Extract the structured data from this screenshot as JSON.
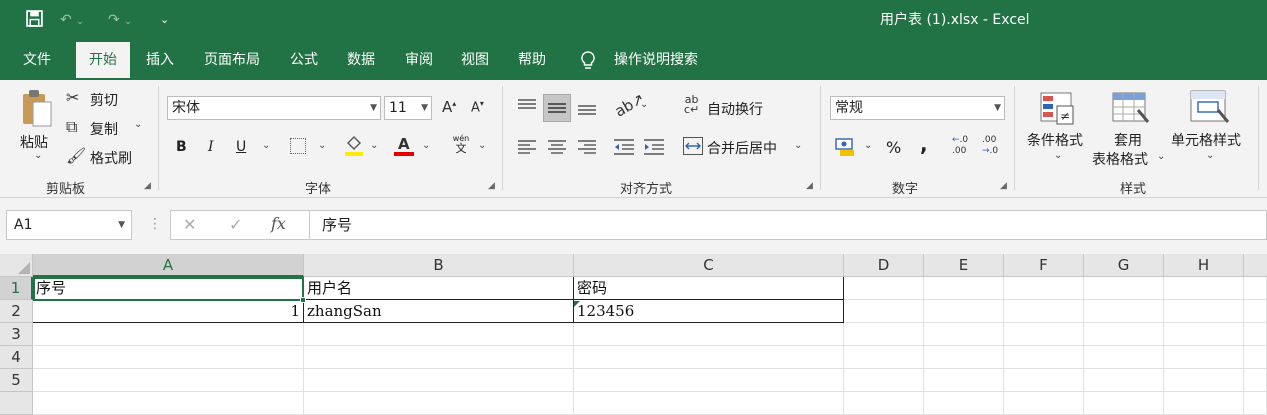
{
  "window": {
    "title": "用户表 (1).xlsx  -  Excel"
  },
  "menu": {
    "items": [
      "文件",
      "开始",
      "插入",
      "页面布局",
      "公式",
      "数据",
      "审阅",
      "视图",
      "帮助",
      "操作说明搜索"
    ],
    "active": "开始"
  },
  "ribbon": {
    "clipboard": {
      "label": "剪贴板",
      "paste": "粘贴",
      "cut": "剪切",
      "copy": "复制",
      "format_painter": "格式刷"
    },
    "font": {
      "label": "字体",
      "name": "宋体",
      "size": "11",
      "bold": "B",
      "italic": "I",
      "underline": "U",
      "font_color_letter": "A",
      "phonetic": "wén",
      "phonetic_char": "文"
    },
    "alignment": {
      "label": "对齐方式",
      "wrap_text": "自动换行",
      "merge_center": "合并后居中"
    },
    "number": {
      "label": "数字",
      "format": "常规",
      "percent": "%",
      "comma": ",",
      "inc_decimal": ".00",
      "dec_decimal": ".0"
    },
    "styles": {
      "label": "样式",
      "conditional_formatting": "条件格式",
      "format_as_table_line1": "套用",
      "format_as_table_line2": "表格格式",
      "cell_styles": "单元格样式"
    }
  },
  "formula_bar": {
    "name_box": "A1",
    "fx": "fx",
    "value": "序号"
  },
  "sheet": {
    "columns": [
      "A",
      "B",
      "C",
      "D",
      "E",
      "F",
      "G",
      "H"
    ],
    "rows": [
      "1",
      "2",
      "3",
      "4",
      "5"
    ],
    "cells": {
      "A1": "序号",
      "B1": "用户名",
      "C1": "密码",
      "A2": "1",
      "B2": "zhangSan",
      "C2": "123456"
    },
    "active_cell": "A1"
  },
  "colors": {
    "accent": "#217346",
    "ribbon_bg": "#f3f3f3"
  }
}
